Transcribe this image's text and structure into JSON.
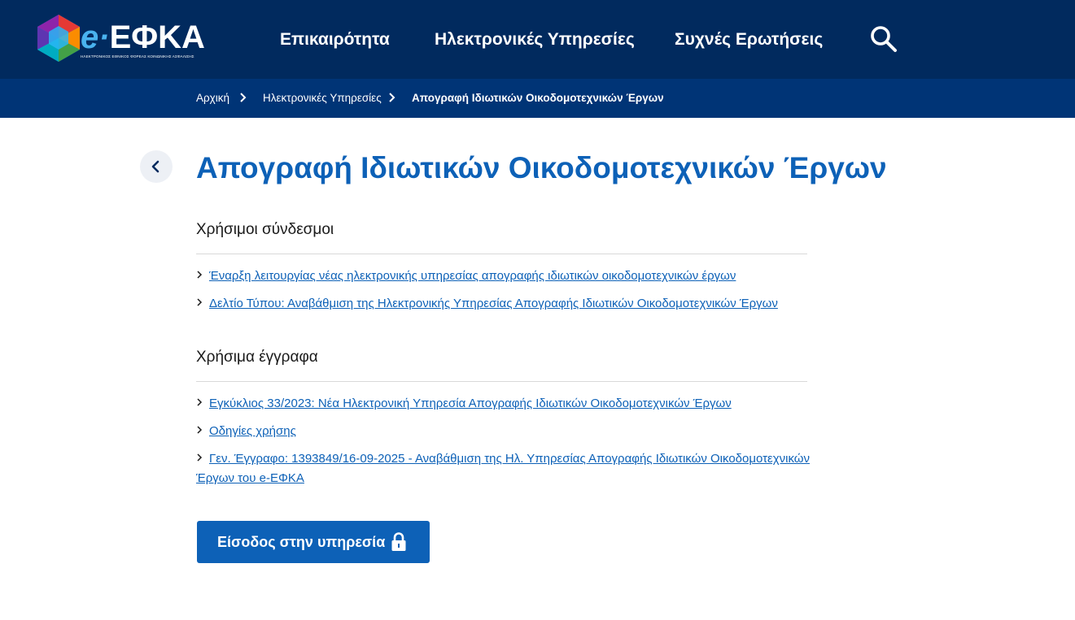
{
  "header": {
    "logo_text_prefix": "e·",
    "logo_text": "ΕΦΚΑ",
    "logo_subtitle": "ΗΛΕΚΤΡΟΝΙΚΟΣ ΕΘΝΙΚΟΣ ΦΟΡΕΑΣ ΚΟΙΝΩΝΙΚΗΣ ΑΣΦΑΛΙΣΗΣ",
    "nav": [
      {
        "label": "Επικαιρότητα"
      },
      {
        "label": "Ηλεκτρονικές Υπηρεσίες"
      },
      {
        "label": "Συχνές Ερωτήσεις"
      }
    ],
    "search_icon": "search-icon",
    "background_color": "#012a5e"
  },
  "breadcrumb": {
    "items": [
      {
        "label": "Αρχική"
      },
      {
        "label": "Ηλεκτρονικές Υπηρεσίες"
      },
      {
        "label": "Απογραφή Ιδιωτικών Οικοδομοτεχνικών Έργων"
      }
    ],
    "background_color": "#003476"
  },
  "main": {
    "back_icon": "chevron-left-icon",
    "title": "Απογραφή Ιδιωτικών Οικοδομοτεχνικών Έργων",
    "sections": [
      {
        "title": "Χρήσιμοι σύνδεσμοι",
        "links": [
          {
            "label": "Έναρξη λειτουργίας νέας ηλεκτρονικής υπηρεσίας απογραφής ιδιωτικών οικοδομοτεχνικών έργων"
          },
          {
            "label": "Δελτίο Τύπου: Αναβάθμιση της Ηλεκτρονικής Υπηρεσίας Απογραφής Ιδιωτικών Οικοδομοτεχνικών Έργων"
          }
        ]
      },
      {
        "title": "Χρήσιμα έγγραφα",
        "links": [
          {
            "label": "Εγκύκλιος 33/2023: Νέα Ηλεκτρονική Υπηρεσία Απογραφής Ιδιωτικών Οικοδομοτεχνικών Έργων"
          },
          {
            "label": "Οδηγίες χρήσης"
          },
          {
            "label_line1": "Γεν. Έγγραφο: 1393849/16-09-2025 - Αναβάθμιση της Ηλ. Υπηρεσίας Απογραφής Ιδιωτικών Οικοδομοτεχνικών",
            "label_line2": "Έργων του e-ΕΦΚΑ"
          }
        ]
      }
    ],
    "login_button": {
      "label": "Είσοδος στην υπηρεσία",
      "icon": "lock-icon"
    },
    "accent_color": "#0d61b7"
  }
}
